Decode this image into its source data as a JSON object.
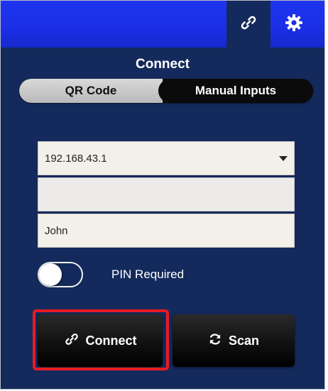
{
  "toolbar": {
    "link_icon": "link-icon",
    "settings_icon": "gear-icon"
  },
  "panel": {
    "title": "Connect"
  },
  "mode_tabs": [
    {
      "label": "QR Code",
      "selected": false
    },
    {
      "label": "Manual Inputs",
      "selected": true
    }
  ],
  "form": {
    "ip_address": "192.168.43.1",
    "second_field": "",
    "name": "John"
  },
  "pin": {
    "label": "PIN Required",
    "enabled": false
  },
  "actions": {
    "connect_label": "Connect",
    "connect_icon": "link-icon",
    "scan_label": "Scan",
    "scan_icon": "refresh-icon"
  },
  "colors": {
    "panel_bg": "#142a5c",
    "topbar_bg": "#1a2fe6",
    "highlight": "#e81b23"
  }
}
